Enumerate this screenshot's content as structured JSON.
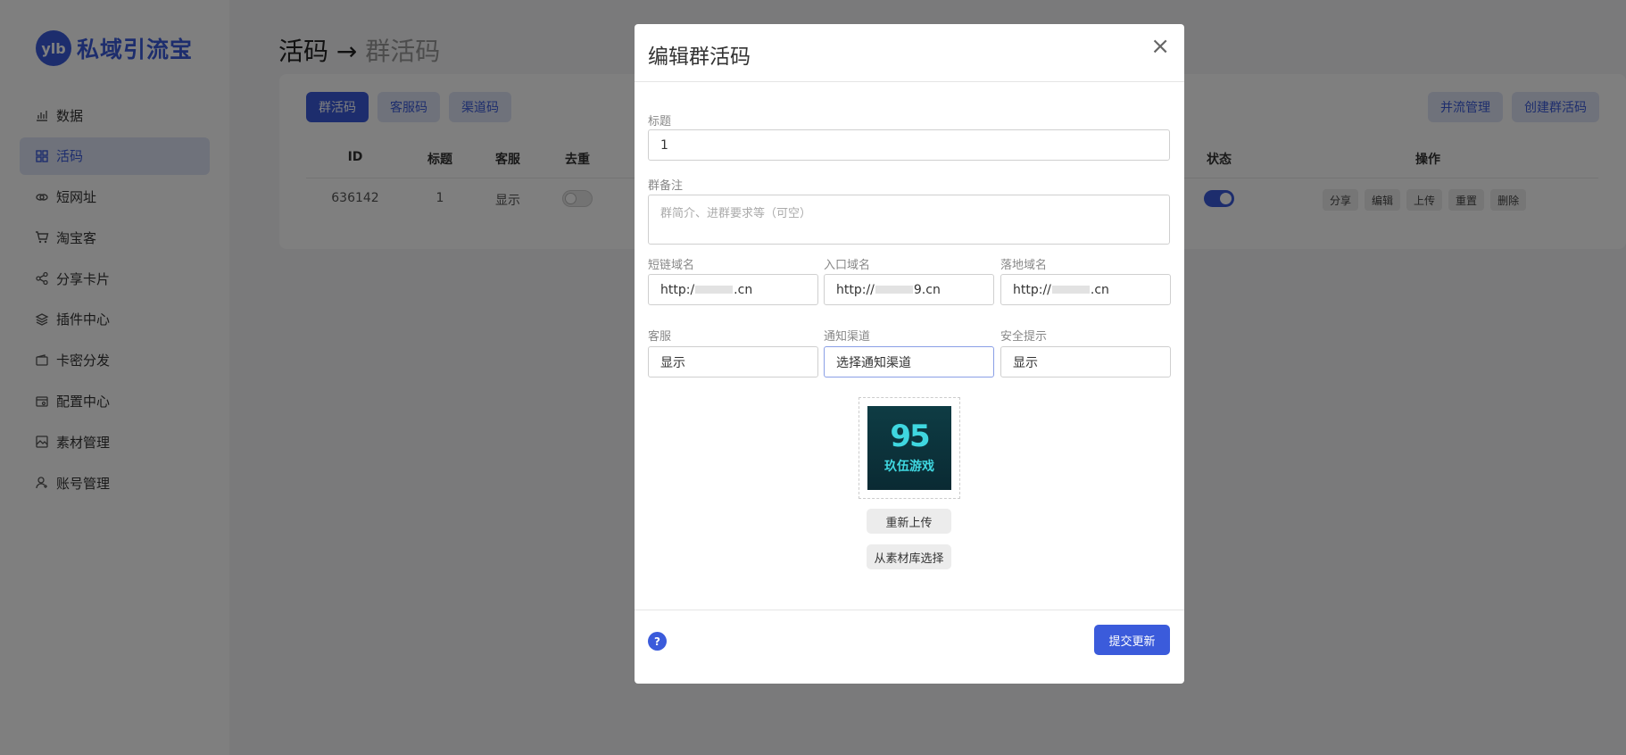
{
  "brand": {
    "badge": "ylb",
    "name": "私域引流宝"
  },
  "sidebar": {
    "items": [
      {
        "label": "数据",
        "icon": "bar-chart-icon"
      },
      {
        "label": "活码",
        "icon": "grid-icon",
        "active": true
      },
      {
        "label": "短网址",
        "icon": "link-icon"
      },
      {
        "label": "淘宝客",
        "icon": "cart-icon"
      },
      {
        "label": "分享卡片",
        "icon": "share-icon"
      },
      {
        "label": "插件中心",
        "icon": "layers-icon"
      },
      {
        "label": "卡密分发",
        "icon": "wallet-icon"
      },
      {
        "label": "配置中心",
        "icon": "config-icon"
      },
      {
        "label": "素材管理",
        "icon": "image-icon"
      },
      {
        "label": "账号管理",
        "icon": "user-icon"
      }
    ]
  },
  "page": {
    "title": "活码",
    "arrow": "→",
    "crumb": "群活码"
  },
  "tabs": [
    "群活码",
    "客服码",
    "渠道码"
  ],
  "top_actions": {
    "merge": "并流管理",
    "create": "创建群活码"
  },
  "table": {
    "headers": {
      "id": "ID",
      "title": "标题",
      "service": "客服",
      "dedupe": "去重",
      "status": "状态",
      "ops": "操作"
    },
    "row": {
      "id": "636142",
      "title": "1",
      "service": "显示"
    },
    "ops": [
      "分享",
      "编辑",
      "上传",
      "重置",
      "删除"
    ]
  },
  "modal": {
    "title": "编辑群活码",
    "close": "×",
    "title_label": "标题",
    "title_value": "1",
    "remark_label": "群备注",
    "remark_placeholder": "群简介、进群要求等（可空）",
    "short_domain_label": "短链域名",
    "short_domain_prefix": "http:/",
    "short_domain_suffix": ".cn",
    "entry_domain_label": "入口域名",
    "entry_domain_prefix": "http://",
    "entry_domain_suffix": "9.cn",
    "landing_domain_label": "落地域名",
    "landing_domain_prefix": "http://",
    "landing_domain_suffix": ".cn",
    "service_label": "客服",
    "service_value": "显示",
    "notify_label": "通知渠道",
    "notify_value": "选择通知渠道",
    "safety_label": "安全提示",
    "safety_value": "显示",
    "image_num": "95",
    "image_text": "玖伍游戏",
    "reupload": "重新上传",
    "from_library": "从素材库选择",
    "help": "?",
    "submit": "提交更新"
  },
  "colors": {
    "accent": "#3b5bdb",
    "overlay": "rgba(0,0,0,0.5)"
  }
}
